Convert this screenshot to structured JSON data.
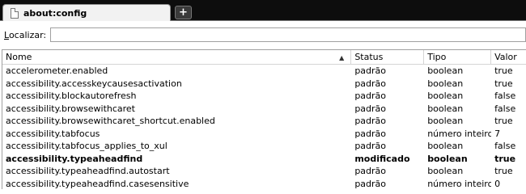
{
  "tab": {
    "title": "about:config",
    "new_tab_label": "+"
  },
  "search": {
    "label_accel": "L",
    "label_rest": "ocalizar:",
    "value": ""
  },
  "columns": [
    "Nome",
    "Status",
    "Tipo",
    "Valor"
  ],
  "rows": [
    {
      "name": "accelerometer.enabled",
      "status": "padrão",
      "type": "boolean",
      "value": "true",
      "modified": false
    },
    {
      "name": "accessibility.accesskeycausesactivation",
      "status": "padrão",
      "type": "boolean",
      "value": "true",
      "modified": false
    },
    {
      "name": "accessibility.blockautorefresh",
      "status": "padrão",
      "type": "boolean",
      "value": "false",
      "modified": false
    },
    {
      "name": "accessibility.browsewithcaret",
      "status": "padrão",
      "type": "boolean",
      "value": "false",
      "modified": false
    },
    {
      "name": "accessibility.browsewithcaret_shortcut.enabled",
      "status": "padrão",
      "type": "boolean",
      "value": "true",
      "modified": false
    },
    {
      "name": "accessibility.tabfocus",
      "status": "padrão",
      "type": "número inteiro",
      "value": "7",
      "modified": false
    },
    {
      "name": "accessibility.tabfocus_applies_to_xul",
      "status": "padrão",
      "type": "boolean",
      "value": "false",
      "modified": false
    },
    {
      "name": "accessibility.typeaheadfind",
      "status": "modificado",
      "type": "boolean",
      "value": "true",
      "modified": true
    },
    {
      "name": "accessibility.typeaheadfind.autostart",
      "status": "padrão",
      "type": "boolean",
      "value": "true",
      "modified": false
    },
    {
      "name": "accessibility.typeaheadfind.casesensitive",
      "status": "padrão",
      "type": "número inteiro",
      "value": "0",
      "modified": false
    }
  ]
}
